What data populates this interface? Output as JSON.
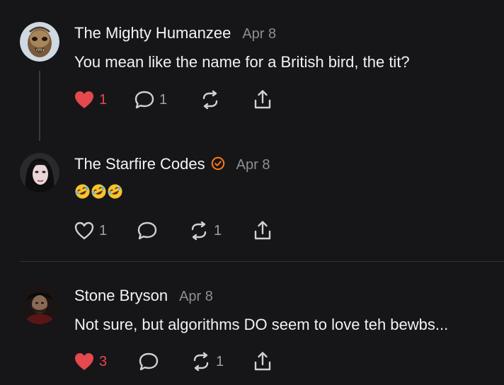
{
  "colors": {
    "background": "#161618",
    "like_red": "#e5484d",
    "muted": "#8e8e93",
    "verified_orange": "#ff7a1a"
  },
  "comments": [
    {
      "author": "The Mighty Humanzee",
      "date": "Apr 8",
      "text": "You mean like the name for a British bird, the tit?",
      "avatar_icon": "creature-mask-avatar",
      "liked": true,
      "like_count": "1",
      "reply_count": "1",
      "restack_count": "",
      "verified": false
    },
    {
      "author": "The Starfire Codes",
      "date": "Apr 8",
      "text": "",
      "emojis": [
        "rolling-on-floor-laughing",
        "rolling-on-floor-laughing",
        "rolling-on-floor-laughing"
      ],
      "avatar_icon": "woman-portrait-avatar",
      "liked": false,
      "like_count": "1",
      "reply_count": "",
      "restack_count": "1",
      "verified": true
    },
    {
      "author": "Stone Bryson",
      "date": "Apr 8",
      "text": "Not sure, but algorithms DO seem to love teh bewbs...",
      "avatar_icon": "man-portrait-avatar",
      "liked": true,
      "like_count": "3",
      "reply_count": "",
      "restack_count": "1",
      "verified": false
    }
  ]
}
